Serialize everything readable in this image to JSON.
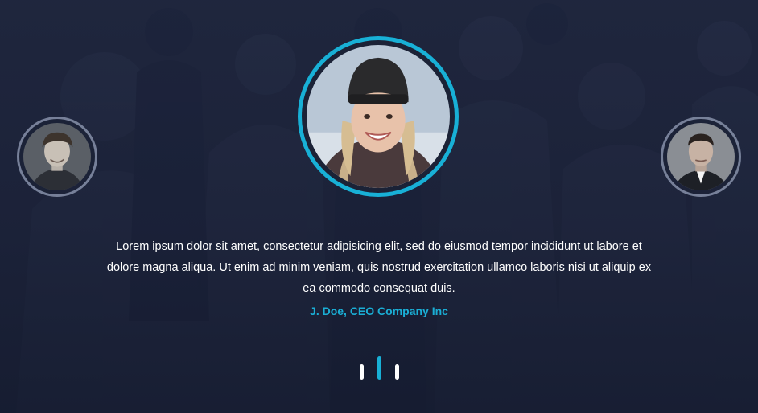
{
  "testimonial": {
    "quote": "Lorem ipsum dolor sit amet, consectetur adipisicing elit, sed do eiusmod tempor incididunt ut labore et dolore magna aliqua. Ut enim ad minim veniam, quis nostrud exercitation ullamco laboris nisi ut aliquip ex ea commodo consequat duis.",
    "author": "J. Doe, CEO Company Inc"
  },
  "avatars": [
    {
      "icon": "person-avatar-icon",
      "position": "left"
    },
    {
      "icon": "person-avatar-icon",
      "position": "center",
      "active": true
    },
    {
      "icon": "person-avatar-icon",
      "position": "right"
    }
  ],
  "pagination": {
    "count": 3,
    "active_index": 1
  },
  "colors": {
    "accent": "#18b0d6",
    "background": "#1b2236",
    "text": "#ffffff",
    "side_ring": "#969fb9"
  }
}
